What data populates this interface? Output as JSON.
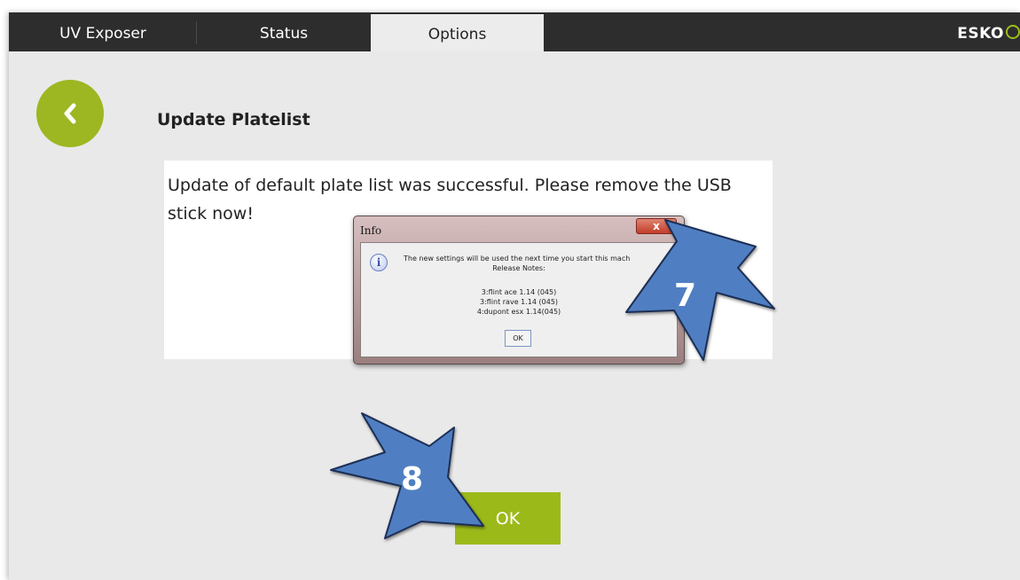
{
  "tabs": [
    {
      "label": "UV Exposer",
      "active": false
    },
    {
      "label": "Status",
      "active": false
    },
    {
      "label": "Options",
      "active": true
    }
  ],
  "brand": {
    "logo_text": "ESKO"
  },
  "page": {
    "title": "Update Platelist",
    "message": "Update of default plate list was successful. Please remove the USB stick now!",
    "ok_label": "OK"
  },
  "dialog": {
    "title": "Info",
    "close_label": "x",
    "lines": [
      "The new settings will be used the next time you start this mach",
      "Release Notes:",
      "3:flint ace 1.14 (045)",
      "3:flint rave 1.14 (045)",
      "4:dupont esx 1.14(045)"
    ],
    "ok_label": "OK"
  },
  "callouts": {
    "step_7": "7",
    "step_8": "8"
  },
  "colors": {
    "accent": "#9cb722",
    "topbar": "#2d2d2d",
    "background": "#e9e9e9",
    "callout_arrow": "#4f7fc2"
  }
}
